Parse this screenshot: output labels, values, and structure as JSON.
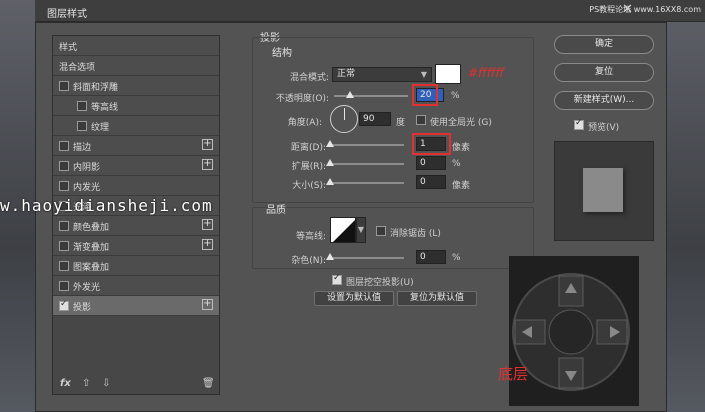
{
  "window": {
    "title": "图层样式",
    "close": "✕",
    "watermark_top": "PS教程论坛 www.16XX8.com"
  },
  "left_list": {
    "items": [
      {
        "label": "样式",
        "checkbox": false,
        "plus": false,
        "selected": false
      },
      {
        "label": "混合选项",
        "checkbox": false,
        "plus": false,
        "selected": false
      },
      {
        "label": "斜面和浮雕",
        "checkbox": true,
        "plus": false,
        "selected": false
      },
      {
        "label": "等高线",
        "checkbox": true,
        "plus": false,
        "selected": false
      },
      {
        "label": "纹理",
        "checkbox": true,
        "plus": false,
        "selected": false
      },
      {
        "label": "描边",
        "checkbox": true,
        "plus": true,
        "selected": false
      },
      {
        "label": "内阴影",
        "checkbox": true,
        "plus": true,
        "selected": false
      },
      {
        "label": "内发光",
        "checkbox": true,
        "plus": false,
        "selected": false
      },
      {
        "label": "光泽",
        "checkbox": true,
        "plus": false,
        "selected": false
      },
      {
        "label": "颜色叠加",
        "checkbox": true,
        "plus": true,
        "selected": false
      },
      {
        "label": "渐变叠加",
        "checkbox": true,
        "plus": true,
        "selected": false
      },
      {
        "label": "图案叠加",
        "checkbox": true,
        "plus": false,
        "selected": false
      },
      {
        "label": "外发光",
        "checkbox": true,
        "plus": false,
        "selected": false
      },
      {
        "label": "投影",
        "checkbox": true,
        "plus": true,
        "selected": true
      }
    ],
    "footer": {
      "fx": "fx",
      "up": "⇧",
      "down": "⇩",
      "trash": "🗑"
    }
  },
  "drop_shadow": {
    "section_title": "投影",
    "structure_title": "结构",
    "blend_mode_label": "混合模式:",
    "blend_mode_value": "正常",
    "color_annotation": "#ffffff",
    "opacity_label": "不透明度(O):",
    "opacity_value": "20",
    "opacity_unit": "%",
    "angle_label": "角度(A):",
    "angle_value": "90",
    "angle_unit": "度",
    "global_light_label": "使用全局光 (G)",
    "distance_label": "距离(D):",
    "distance_value": "1",
    "distance_unit": "像素",
    "spread_label": "扩展(R):",
    "spread_value": "0",
    "spread_unit": "%",
    "size_label": "大小(S):",
    "size_value": "0",
    "size_unit": "像素",
    "quality_title": "品质",
    "contour_label": "等高线:",
    "anti_alias_label": "消除锯齿 (L)",
    "noise_label": "杂色(N):",
    "noise_value": "0",
    "noise_unit": "%",
    "knockout_label": "图层挖空投影(U)",
    "make_default": "设置为默认值",
    "reset_default": "复位为默认值"
  },
  "buttons": {
    "ok": "确定",
    "reset": "复位",
    "new_style": "新建样式(W)...",
    "preview_label": "预览(V)"
  },
  "watermark_mid": "w.haoyidiansheji.com",
  "annotation_bottom": "底层",
  "colors": {
    "accent_red": "#e03030",
    "panel": "#535353"
  }
}
